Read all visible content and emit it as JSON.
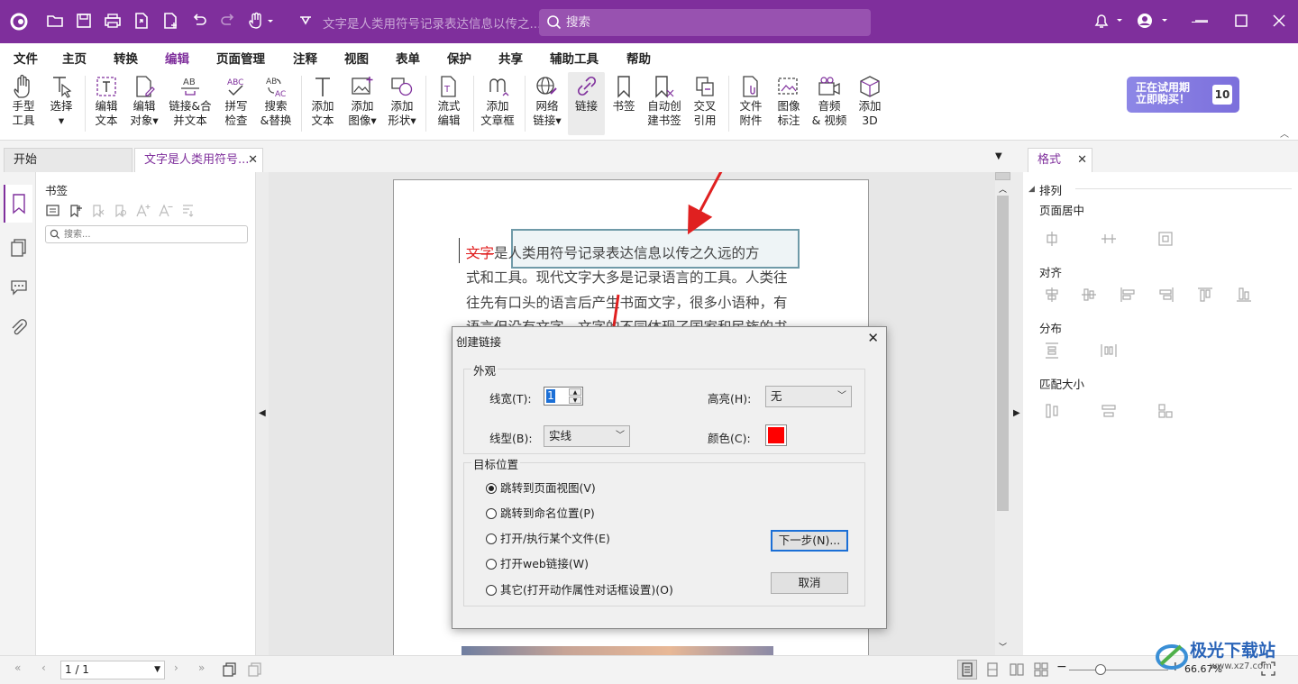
{
  "titlebar": {
    "doc_title": "文字是人类用符号记录表达信息以传之...",
    "search_placeholder": "搜索"
  },
  "menu": [
    "文件",
    "主页",
    "转换",
    "编辑",
    "页面管理",
    "注释",
    "视图",
    "表单",
    "保护",
    "共享",
    "辅助工具",
    "帮助"
  ],
  "ribbon": {
    "hand": [
      "手型",
      "工具"
    ],
    "select": [
      "选择",
      ""
    ],
    "edit_text": [
      "编辑",
      "文本"
    ],
    "edit_object": [
      "编辑",
      "对象▾"
    ],
    "link_merge": [
      "链接&合",
      "并文本"
    ],
    "spell": [
      "拼写",
      "检查"
    ],
    "search_replace": [
      "搜索",
      "&替换"
    ],
    "add_text": [
      "添加",
      "文本"
    ],
    "add_image": [
      "添加",
      "图像▾"
    ],
    "add_shape": [
      "添加",
      "形状▾"
    ],
    "flow_edit": [
      "流式",
      "编辑"
    ],
    "add_article": [
      "添加",
      "文章框"
    ],
    "web_link": [
      "网络",
      "链接▾"
    ],
    "link": [
      "链接",
      ""
    ],
    "bookmark": [
      "书签",
      ""
    ],
    "auto_bookmark": [
      "自动创",
      "建书签"
    ],
    "cross_ref": [
      "交叉",
      "引用"
    ],
    "file_attach": [
      "文件",
      "附件"
    ],
    "image_mark": [
      "图像",
      "标注"
    ],
    "audio_video": [
      "音频",
      "& 视频"
    ],
    "add_3d": [
      "添加",
      "3D"
    ]
  },
  "trial": {
    "line1": "正在试用期",
    "line2": "立即购买！",
    "days": "10"
  },
  "tabs": {
    "start": "开始",
    "doc": "文字是人类用符号..."
  },
  "bookmarks": {
    "title": "书签",
    "search_placeholder": "搜索..."
  },
  "page_text": {
    "line1_red": "文字",
    "line1_rest": "是人类用符号记录表达信息以传之久远的方",
    "line2": "式和工具。现代文字大多是记录语言的工具。人类往",
    "line3": "往先有口头的语言后产生书面文字，很多小语种，有",
    "line4": "语言但没有文字。文字的不同体现了国家和民族的书"
  },
  "format_panel": {
    "tab": "格式",
    "arrange": "排列",
    "page_center": "页面居中",
    "align": "对齐",
    "distribute": "分布",
    "match_size": "匹配大小"
  },
  "dialog": {
    "title": "创建链接",
    "appearance": "外观",
    "line_width_label": "线宽(T):",
    "line_width_value": "1",
    "highlight_label": "高亮(H):",
    "highlight_value": "无",
    "line_style_label": "线型(B):",
    "line_style_value": "实线",
    "color_label": "颜色(C):",
    "color_value": "#ff0000",
    "target": "目标位置",
    "options": [
      "跳转到页面视图(V)",
      "跳转到命名位置(P)",
      "打开/执行某个文件(E)",
      "打开web链接(W)",
      "其它(打开动作属性对话框设置)(O)"
    ],
    "selected_option": 0,
    "next_button": "下一步(N)...",
    "cancel_button": "取消"
  },
  "status": {
    "page": "1 / 1",
    "zoom": "66.67%"
  },
  "watermark": {
    "text": "极光下载站",
    "url": "www.xz7.com"
  },
  "colors": {
    "brand": "#7f2f9c",
    "arrow": "#e02020"
  }
}
